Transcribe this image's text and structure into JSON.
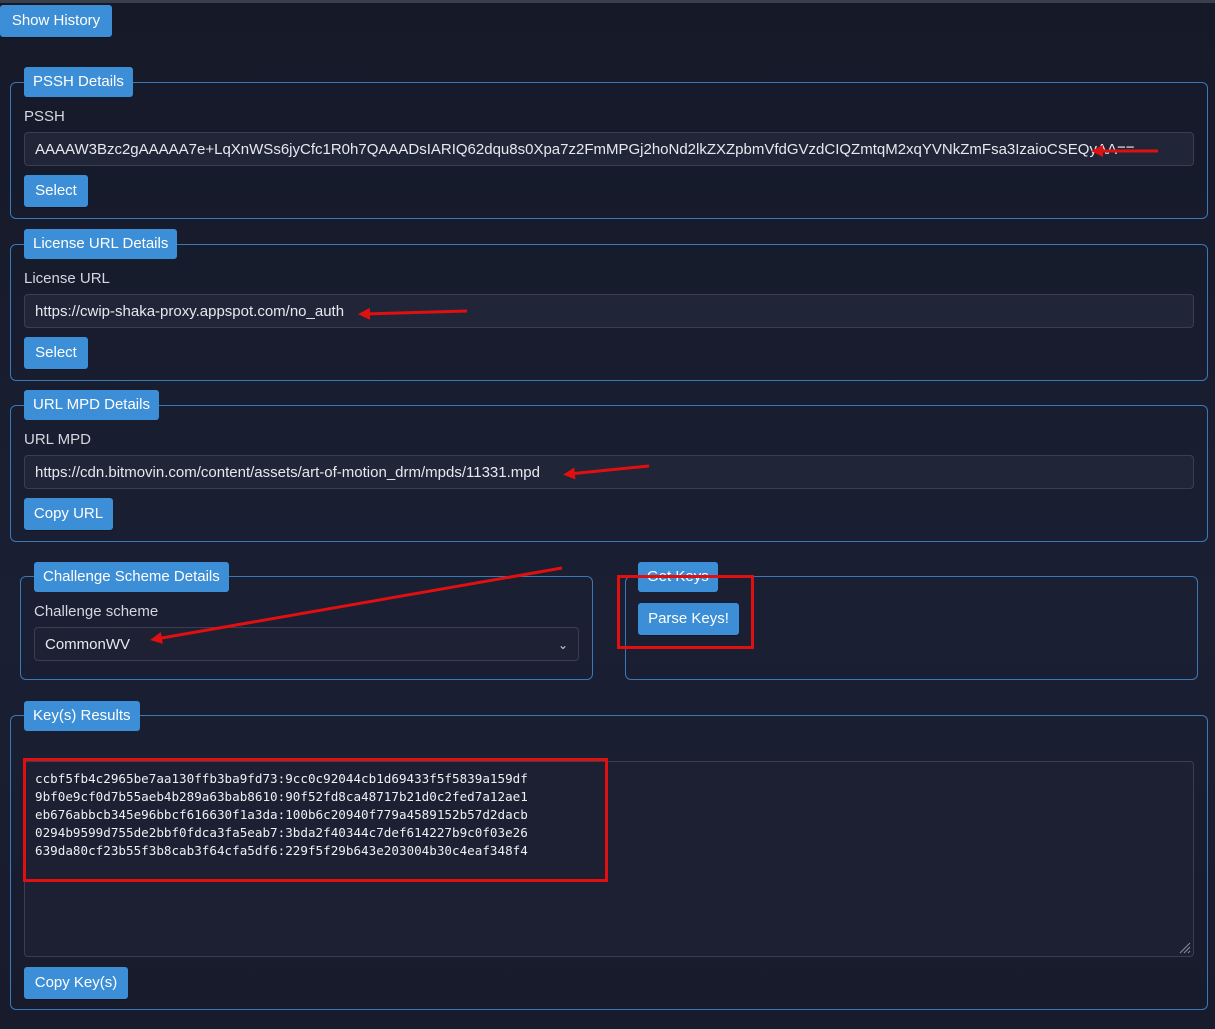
{
  "toolbar": {
    "show_history_label": "Show History"
  },
  "pssh": {
    "legend": "PSSH Details",
    "label": "PSSH",
    "value": "AAAAW3Bzc2gAAAAA7e+LqXnWSs6jyCfc1R0h7QAAADsIARIQ62dqu8s0Xpa7z2FmMPGj2hoNd2lkZXZpbmVfdGVzdCIQZmtqM2xqYVNkZmFsa3IzaioCSEQyAA==",
    "button_label": "Select"
  },
  "license": {
    "legend": "License URL Details",
    "label": "License URL",
    "value": "https://cwip-shaka-proxy.appspot.com/no_auth",
    "button_label": "Select"
  },
  "mpd": {
    "legend": "URL MPD Details",
    "label": "URL MPD",
    "value": "https://cdn.bitmovin.com/content/assets/art-of-motion_drm/mpds/11331.mpd",
    "button_label": "Copy URL"
  },
  "challenge": {
    "legend": "Challenge Scheme Details",
    "label": "Challenge scheme",
    "selected": "CommonWV"
  },
  "get_keys": {
    "legend": "Get Keys",
    "button_label": "Parse Keys!"
  },
  "results": {
    "legend": "Key(s) Results",
    "keys": "ccbf5fb4c2965be7aa130ffb3ba9fd73:9cc0c92044cb1d69433f5f5839a159df\n9bf0e9cf0d7b55aeb4b289a63bab8610:90f52fd8ca48717b21d0c2fed7a12ae1\neb676abbcb345e96bbcf616630f1a3da:100b6c20940f779a4589152b57d2dacb\n0294b9599d755de2bbf0fdca3fa5eab7:3bda2f40344c7def614227b9c0f03e26\n639da80cf23b55f3b8cab3f64cfa5df6:229f5f29b643e203004b30c4eaf348f4",
    "button_label": "Copy Key(s)"
  },
  "colors": {
    "accent": "#3c8ed6",
    "annotation": "#e01010",
    "background": "#161a2c"
  }
}
